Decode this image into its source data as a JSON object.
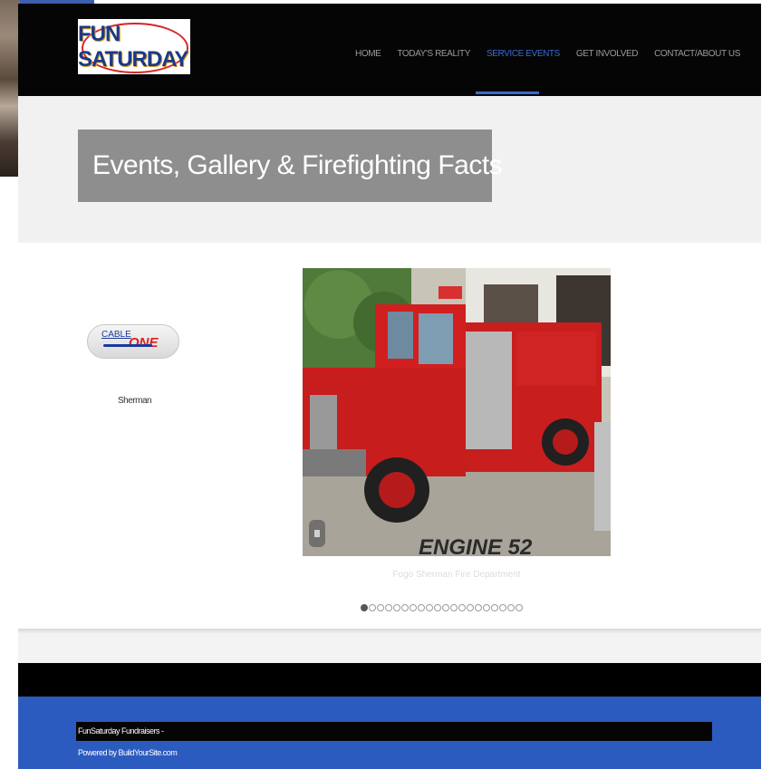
{
  "header": {
    "logo_text": "FUN SATURDAY",
    "nav": [
      {
        "label": "HOME",
        "active": false
      },
      {
        "label": "TODAY'S REALITY",
        "active": false
      },
      {
        "label": "SERVICE EVENTS",
        "active": true
      },
      {
        "label": "GET INVOLVED",
        "active": false
      },
      {
        "label": "CONTACT/ABOUT US",
        "active": false
      }
    ]
  },
  "page_title": "Events, Gallery & Firefighting Facts",
  "sponsor": {
    "logo_part1": "CABLE",
    "logo_part2": "ONE",
    "name": "Sherman"
  },
  "slideshow": {
    "image_text": "ENGINE 52",
    "caption": "Fogo Sherman Fire Department",
    "slide_count": 20,
    "active_index": 0
  },
  "footer": {
    "line1": "FunSaturday Fundraisers -",
    "line2": "Powered by BuildYourSite.com"
  },
  "colors": {
    "header_bg": "#050505",
    "nav_active": "#3a6ad0",
    "footer_blue": "#2c5bbf",
    "title_box": "#8e8e8e"
  }
}
